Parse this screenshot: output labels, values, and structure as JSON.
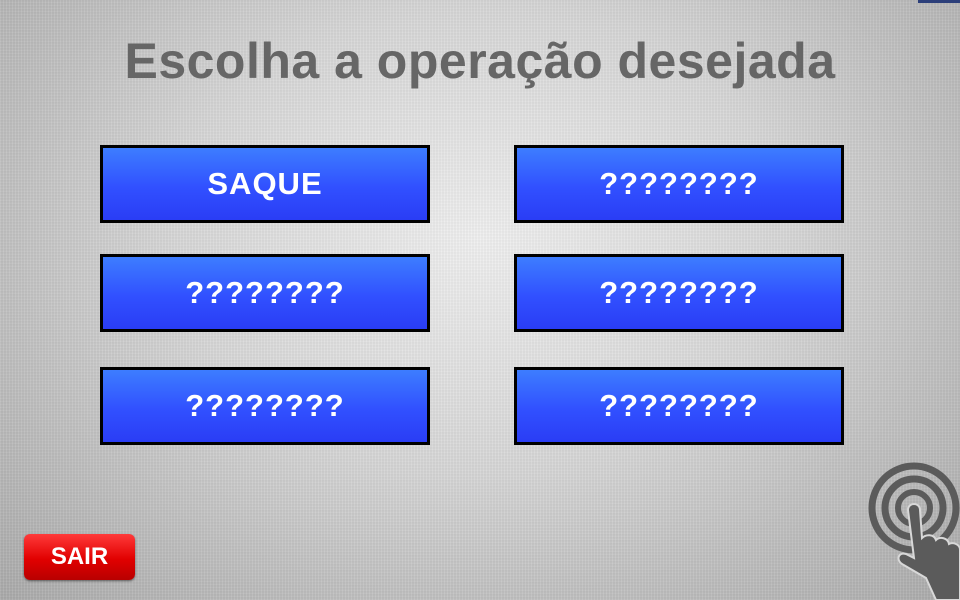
{
  "screen": {
    "title": "Escolha a operação desejada"
  },
  "operations": [
    {
      "label": "SAQUE"
    },
    {
      "label": "????????"
    },
    {
      "label": "????????"
    },
    {
      "label": "????????"
    },
    {
      "label": "????????"
    },
    {
      "label": "????????"
    }
  ],
  "exit_button": {
    "label": "SAIR"
  },
  "icons": {
    "touch": "touch-hand-icon"
  },
  "colors": {
    "button_blue": "#3150ff",
    "exit_red": "#e10000",
    "title_gray": "#666666"
  }
}
